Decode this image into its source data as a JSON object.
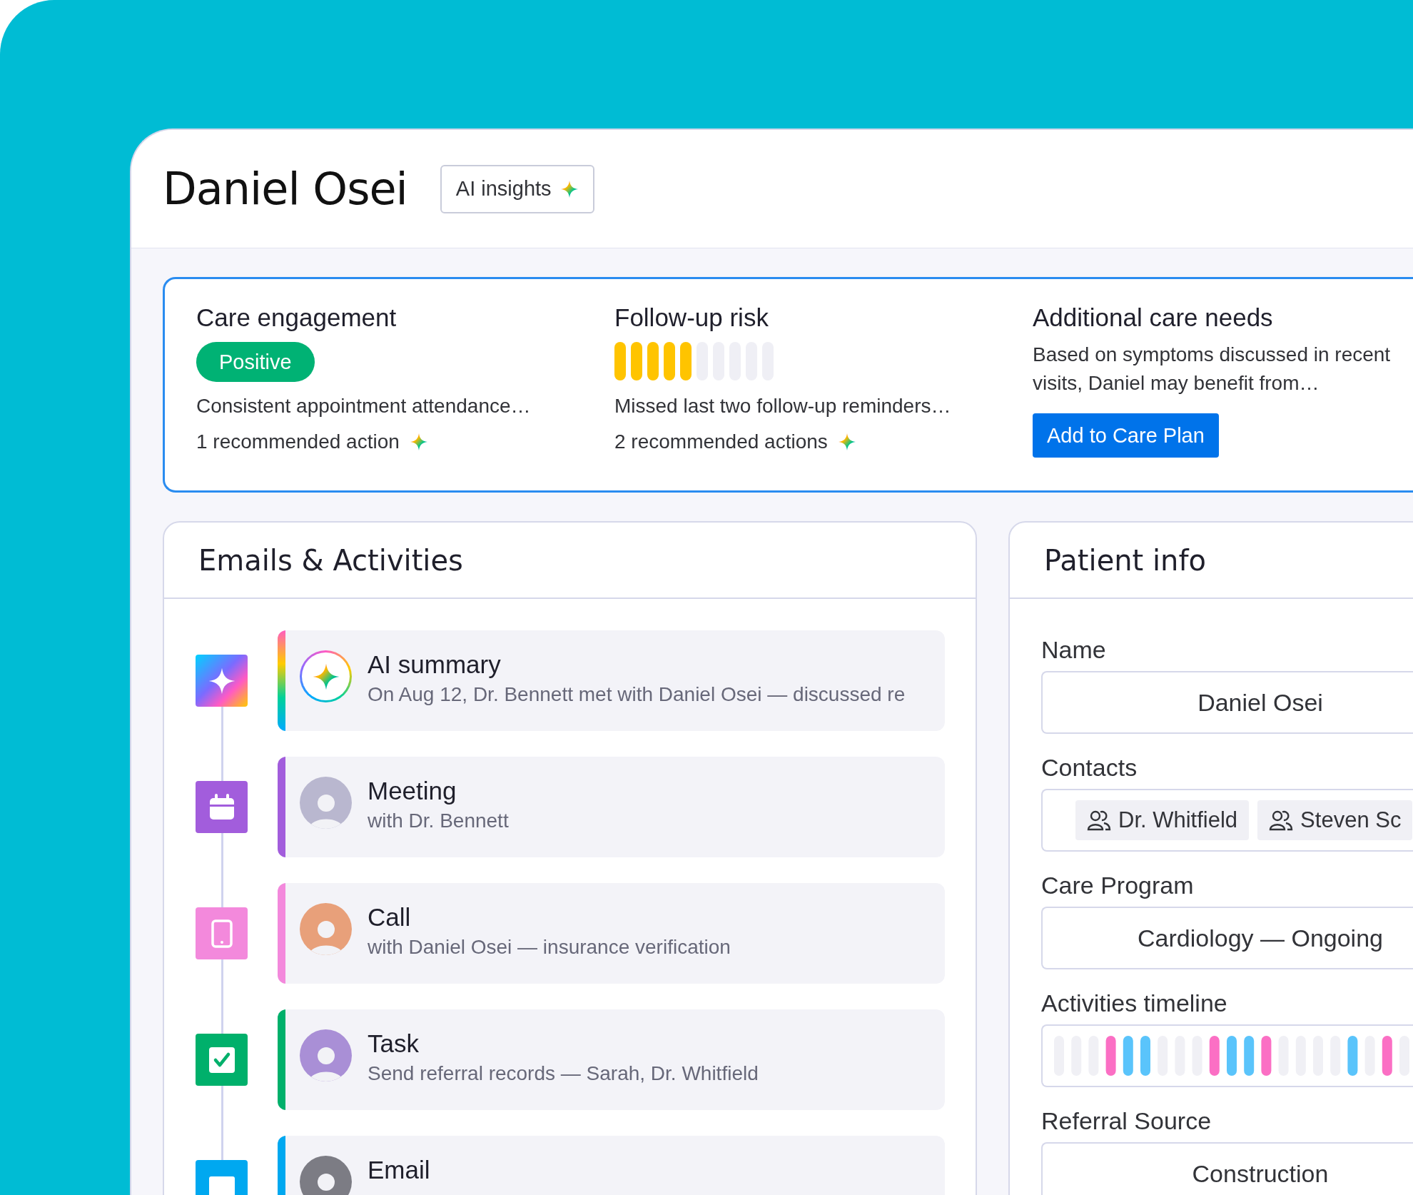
{
  "header": {
    "title": "Daniel Osei",
    "ai_button": "AI insights"
  },
  "insights": [
    {
      "kind": "badge",
      "title": "Care engagement",
      "badge": "Positive",
      "summary": "Consistent appointment attendance…",
      "actions": "1 recommended action"
    },
    {
      "kind": "meter",
      "title": "Follow-up risk",
      "level": 0.5,
      "summary": "Missed last two follow-up reminders…",
      "actions": "2 recommended actions"
    },
    {
      "kind": "cta",
      "title": "Additional care needs",
      "summary": "Based on symptoms discussed in recent visits, Daniel may benefit from…",
      "button": "Add to Care Plan"
    }
  ],
  "activities": {
    "title": "Emails & Activities",
    "items": [
      {
        "kind": "ai",
        "title": "AI summary",
        "subtitle": "On Aug 12, Dr. Bennett met with Daniel Osei — discussed re"
      },
      {
        "kind": "meeting",
        "title": "Meeting",
        "subtitle": "with Dr. Bennett"
      },
      {
        "kind": "call",
        "title": "Call",
        "subtitle": "with Daniel Osei — insurance verification"
      },
      {
        "kind": "task",
        "title": "Task",
        "subtitle": "Send referral records — Sarah, Dr. Whitfield"
      },
      {
        "kind": "email",
        "title": "Email"
      }
    ]
  },
  "patient_info": {
    "title": "Patient info",
    "fields": [
      {
        "kind": "text",
        "label": "Name",
        "value": "Daniel Osei"
      },
      {
        "kind": "contacts",
        "label": "Contacts",
        "contacts": [
          "Dr. Whitfield",
          "Steven Sc"
        ]
      },
      {
        "kind": "text",
        "label": "Care Program",
        "value": "Cardiology — Ongoing"
      },
      {
        "kind": "timeline",
        "label": "Activities timeline"
      },
      {
        "kind": "text",
        "label": "Referral Source",
        "value": "Construction"
      }
    ]
  }
}
